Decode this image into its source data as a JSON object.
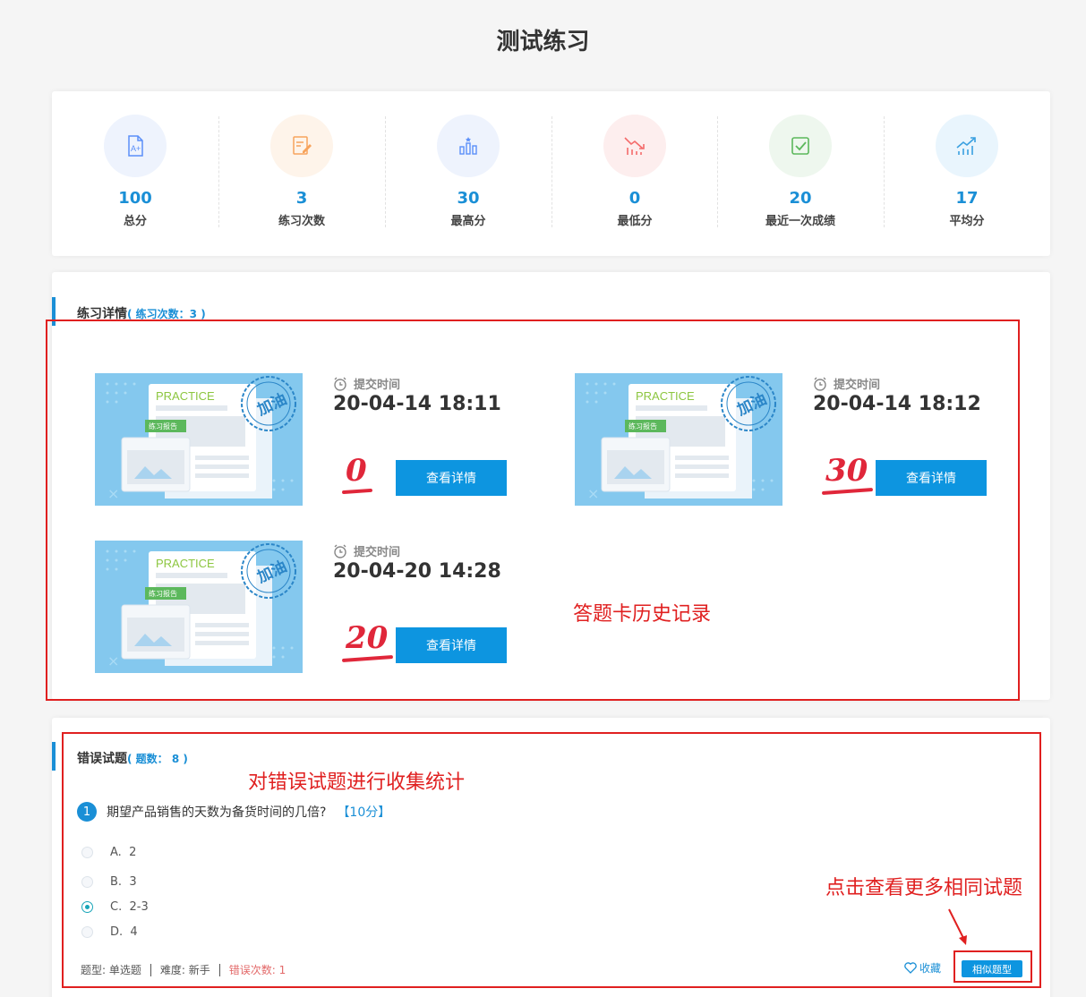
{
  "title": "测试练习",
  "stats": [
    {
      "value": "100",
      "label": "总分",
      "icon": "grade-a-plus-icon",
      "color": "#5b8ff9",
      "bg": "#eef3fd"
    },
    {
      "value": "3",
      "label": "练习次数",
      "icon": "edit-document-icon",
      "color": "#f7a35c",
      "bg": "#fef4ea"
    },
    {
      "value": "30",
      "label": "最高分",
      "icon": "bar-chart-icon",
      "color": "#5b8ff9",
      "bg": "#eef3fd"
    },
    {
      "value": "0",
      "label": "最低分",
      "icon": "trend-down-icon",
      "color": "#f46b6b",
      "bg": "#fdeeee"
    },
    {
      "value": "20",
      "label": "最近一次成绩",
      "icon": "checkbox-icon",
      "color": "#5cb85c",
      "bg": "#eef7ee"
    },
    {
      "value": "17",
      "label": "平均分",
      "icon": "trend-up-icon",
      "color": "#3aa0e0",
      "bg": "#e9f5fd"
    }
  ],
  "detail": {
    "title": "练习详情",
    "count_label": "( 练习次数：3 )",
    "records": [
      {
        "time_label": "提交时间",
        "time": "20-04-14 18:11",
        "score": "0",
        "button": "查看详情",
        "thumb_title": "PRACTICE",
        "thumb_tag": "练习报告",
        "thumb_stamp": "加油"
      },
      {
        "time_label": "提交时间",
        "time": "20-04-14 18:12",
        "score": "30",
        "button": "查看详情",
        "thumb_title": "PRACTICE",
        "thumb_tag": "练习报告",
        "thumb_stamp": "加油"
      },
      {
        "time_label": "提交时间",
        "time": "20-04-20 14:28",
        "score": "20",
        "button": "查看详情",
        "thumb_title": "PRACTICE",
        "thumb_tag": "练习报告",
        "thumb_stamp": "加油"
      }
    ]
  },
  "wrong": {
    "title": "错误试题",
    "count_label": "( 题数：  8 )",
    "question": {
      "number": "1",
      "text": "期望产品销售的天数为备货时间的几倍?",
      "score": "【10分】",
      "options": [
        {
          "label": "A.",
          "text": "2",
          "checked": false
        },
        {
          "label": "B.",
          "text": "3",
          "checked": false
        },
        {
          "label": "C.",
          "text": "2-3",
          "checked": true
        },
        {
          "label": "D.",
          "text": "4",
          "checked": false
        }
      ],
      "type": "题型: 单选题",
      "difficulty": "难度: 新手",
      "errors": "错误次数: 1",
      "favorite": "收藏",
      "similar": "相似题型"
    }
  },
  "annotations": {
    "history": "答题卡历史记录",
    "collect": "对错误试题进行收集统计",
    "more": "点击查看更多相同试题"
  }
}
